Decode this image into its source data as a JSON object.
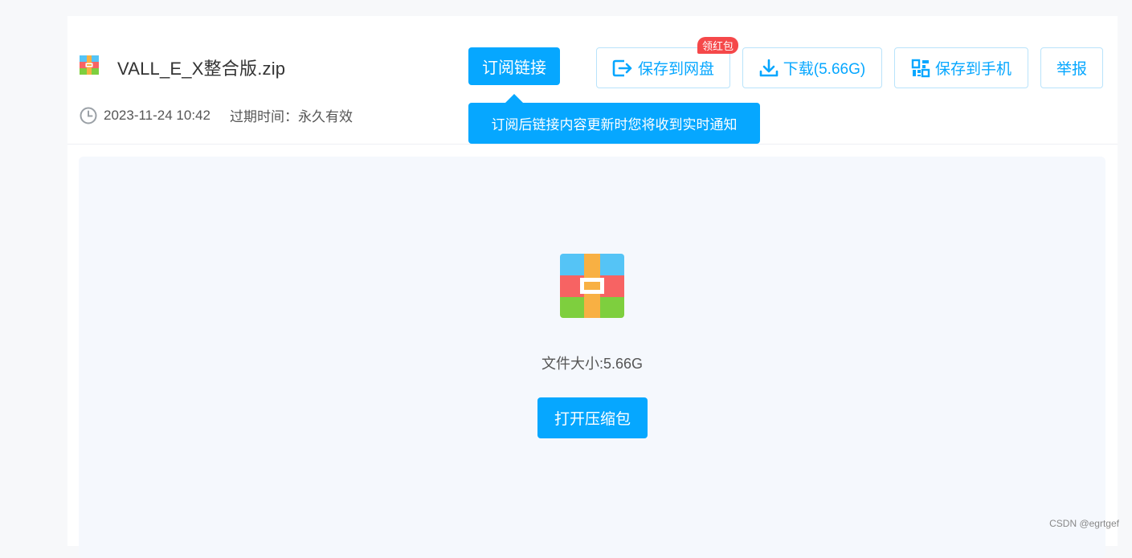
{
  "file": {
    "name": "VALL_E_X整合版.zip",
    "date": "2023-11-24 10:42",
    "expire_label": "过期时间：",
    "expire_value": "永久有效",
    "size_text": "文件大小:5.66G"
  },
  "subscribe": {
    "label": "订阅链接",
    "tooltip": "订阅后链接内容更新时您将收到实时通知"
  },
  "actions": {
    "save_disk": "保存到网盘",
    "badge": "领红包",
    "download": "下载(5.66G)",
    "save_phone": "保存到手机",
    "report": "举报"
  },
  "preview": {
    "open_label": "打开压缩包"
  },
  "watermark": "CSDN @egrtgef",
  "colors": {
    "accent": "#06a7ff",
    "badge": "#f5484a",
    "zip_blue": "#55c4f6",
    "zip_red": "#f76363",
    "zip_green": "#7ecf3e",
    "zip_orange": "#f8b043"
  }
}
